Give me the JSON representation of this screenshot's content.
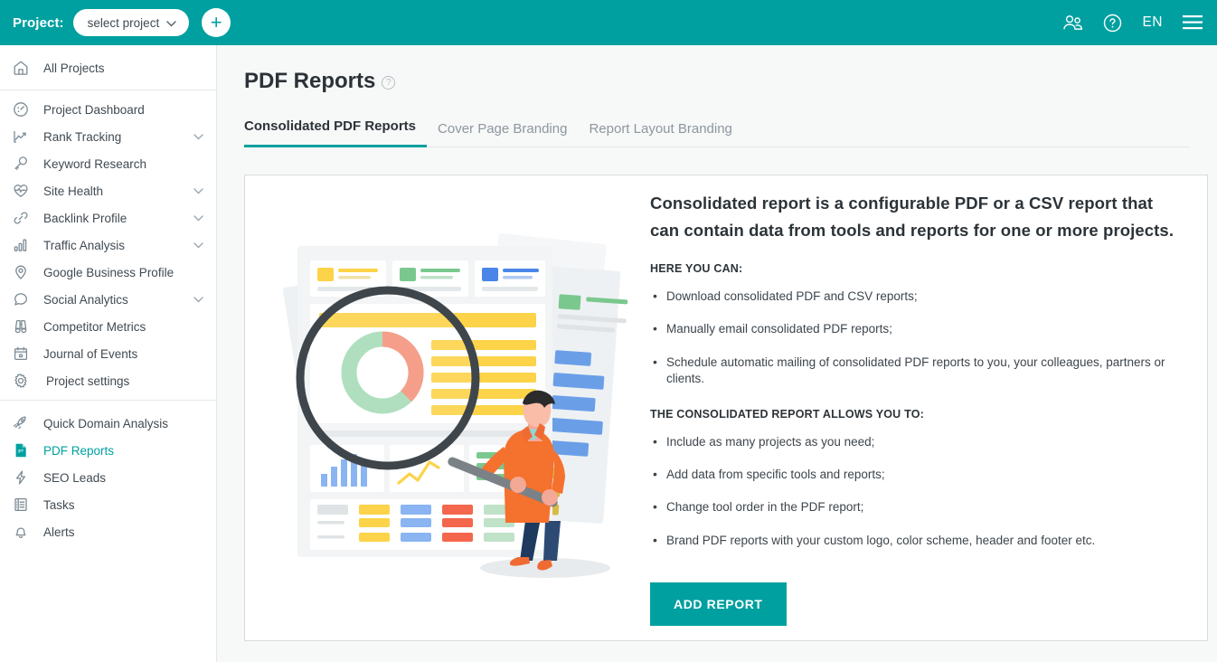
{
  "topbar": {
    "project_label": "Project:",
    "project_select_value": "select project",
    "add_button_label": "+",
    "language": "EN",
    "icons": {
      "users": "users-icon",
      "help": "help-icon",
      "menu": "hamburger-menu-icon"
    }
  },
  "sidebar": {
    "top": [
      {
        "label": "All Projects",
        "icon": "home-icon",
        "caret": false,
        "active": false
      }
    ],
    "middle": [
      {
        "label": "Project Dashboard",
        "icon": "dashboard-icon",
        "caret": false,
        "active": false
      },
      {
        "label": "Rank Tracking",
        "icon": "chart-line-icon",
        "caret": true,
        "active": false
      },
      {
        "label": "Keyword Research",
        "icon": "key-icon",
        "caret": false,
        "active": false
      },
      {
        "label": "Site Health",
        "icon": "heartbeat-icon",
        "caret": true,
        "active": false
      },
      {
        "label": "Backlink Profile",
        "icon": "link-icon",
        "caret": true,
        "active": false
      },
      {
        "label": "Traffic Analysis",
        "icon": "bar-chart-icon",
        "caret": true,
        "active": false
      },
      {
        "label": "Google Business Profile",
        "icon": "map-pin-icon",
        "caret": false,
        "active": false
      },
      {
        "label": "Social Analytics",
        "icon": "chat-bubble-icon",
        "caret": true,
        "active": false
      },
      {
        "label": "Competitor Metrics",
        "icon": "binoculars-icon",
        "caret": false,
        "active": false
      },
      {
        "label": "Journal of Events",
        "icon": "calendar-icon",
        "caret": false,
        "active": false
      },
      {
        "label": "Project settings",
        "icon": "gear-icon",
        "caret": false,
        "active": false
      }
    ],
    "bottom": [
      {
        "label": "Quick Domain Analysis",
        "icon": "rocket-icon",
        "caret": false,
        "active": false
      },
      {
        "label": "PDF Reports",
        "icon": "pdf-file-icon",
        "caret": false,
        "active": true
      },
      {
        "label": "SEO Leads",
        "icon": "bolt-icon",
        "caret": false,
        "active": false
      },
      {
        "label": "Tasks",
        "icon": "list-icon",
        "caret": false,
        "active": false
      },
      {
        "label": "Alerts",
        "icon": "bell-icon",
        "caret": false,
        "active": false
      }
    ]
  },
  "page": {
    "title": "PDF Reports",
    "help_glyph": "?",
    "tabs": [
      {
        "label": "Consolidated PDF Reports",
        "active": true
      },
      {
        "label": "Cover Page Branding",
        "active": false
      },
      {
        "label": "Report Layout Branding",
        "active": false
      }
    ]
  },
  "content": {
    "heading": "Consolidated report is a configurable PDF or a CSV report that can contain data from tools and reports for one or more projects.",
    "section1_label": "HERE YOU CAN:",
    "section1_items": [
      "Download consolidated PDF and CSV reports;",
      "Manually email consolidated PDF reports;",
      "Schedule automatic mailing of consolidated PDF reports to you, your colleagues, partners or clients."
    ],
    "section2_label": "THE CONSOLIDATED REPORT ALLOWS YOU TO:",
    "section2_items": [
      "Include as many projects as you need;",
      "Add data from specific tools and reports;",
      "Change tool order in the PDF report;",
      "Brand PDF reports with your custom logo, color scheme, header and footer etc."
    ],
    "cta_label": "ADD REPORT"
  },
  "colors": {
    "brand_teal": "#00a0a0",
    "text_dark": "#2c3338",
    "text_muted": "#8d979e",
    "border": "#e3e6e8",
    "page_bg": "#f7f8f8"
  }
}
